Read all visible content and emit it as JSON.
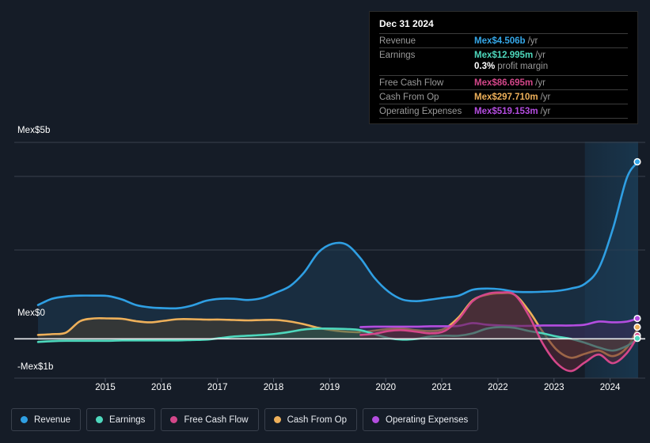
{
  "background_color": "#151c27",
  "tooltip": {
    "date": "Dec 31 2024",
    "rows": [
      {
        "label": "Revenue",
        "value": "Mex$4.506b",
        "unit": "/yr",
        "color": "#35a7e8"
      },
      {
        "label": "Earnings",
        "value": "Mex$12.995m",
        "unit": "/yr",
        "color": "#4ed8bd"
      },
      {
        "label": "",
        "value": "0.3%",
        "unit": "profit margin",
        "color": "#ffffff",
        "sub": true
      },
      {
        "label": "Free Cash Flow",
        "value": "Mex$86.695m",
        "unit": "/yr",
        "color": "#d4478a"
      },
      {
        "label": "Cash From Op",
        "value": "Mex$297.710m",
        "unit": "/yr",
        "color": "#eeb05a"
      },
      {
        "label": "Operating Expenses",
        "value": "Mex$519.153m",
        "unit": "/yr",
        "color": "#b44de0"
      }
    ]
  },
  "y_axis": {
    "top_label": "Mex$5b",
    "zero_label": "Mex$0",
    "bottom_label": "-Mex$1b"
  },
  "legend": {
    "items": [
      {
        "label": "Revenue",
        "color": "#2f9fe3"
      },
      {
        "label": "Earnings",
        "color": "#4ed8bd"
      },
      {
        "label": "Free Cash Flow",
        "color": "#d4478a"
      },
      {
        "label": "Cash From Op",
        "color": "#eeb05a"
      },
      {
        "label": "Operating Expenses",
        "color": "#b44de0"
      }
    ]
  },
  "chart_data": {
    "type": "area",
    "title": "",
    "xlabel": "",
    "ylabel": "Mex$",
    "ylim": [
      -1.0,
      5.0
    ],
    "y_ticks": [
      5.0,
      4.0,
      2.0,
      0.0,
      -1.0
    ],
    "y_tick_labels": [
      "Mex$5b",
      "",
      "",
      "Mex$0",
      "-Mex$1b"
    ],
    "grid": true,
    "legend_position": "bottom",
    "x_tick_labels": [
      "2015",
      "2016",
      "2017",
      "2018",
      "2019",
      "2020",
      "2021",
      "2022",
      "2023",
      "2024"
    ],
    "x": [
      2014.3,
      2014.55,
      2014.8,
      2015.05,
      2015.3,
      2015.55,
      2015.8,
      2016.05,
      2016.3,
      2016.55,
      2016.8,
      2017.05,
      2017.3,
      2017.55,
      2017.8,
      2018.05,
      2018.3,
      2018.55,
      2018.8,
      2019.05,
      2019.3,
      2019.55,
      2019.8,
      2020.05,
      2020.3,
      2020.55,
      2020.8,
      2021.05,
      2021.3,
      2021.55,
      2021.8,
      2022.05,
      2022.3,
      2022.55,
      2022.8,
      2023.05,
      2023.3,
      2023.55,
      2023.8,
      2024.05,
      2024.3,
      2024.55,
      2024.8,
      2025.0
    ],
    "forecast_start_x": 2024.05,
    "end_markers": [
      {
        "series": "Revenue",
        "value": 4.506,
        "color": "#35a7e8"
      },
      {
        "series": "Operating Expenses",
        "value": 0.519,
        "color": "#b44de0"
      },
      {
        "series": "Cash From Op",
        "value": 0.298,
        "color": "#eeb05a"
      },
      {
        "series": "Free Cash Flow",
        "value": 0.087,
        "color": "#d4478a"
      },
      {
        "series": "Earnings",
        "value": 0.013,
        "color": "#4ed8bd"
      }
    ],
    "series": [
      {
        "name": "Revenue",
        "color": "#2f9fe3",
        "fill": "#1d3c56",
        "values": [
          0.86,
          1.02,
          1.08,
          1.1,
          1.1,
          1.09,
          1.0,
          0.86,
          0.8,
          0.78,
          0.78,
          0.85,
          0.97,
          1.02,
          1.02,
          0.99,
          1.04,
          1.18,
          1.35,
          1.7,
          2.2,
          2.42,
          2.4,
          2.05,
          1.55,
          1.2,
          1.0,
          0.96,
          1.0,
          1.05,
          1.1,
          1.25,
          1.28,
          1.26,
          1.2,
          1.19,
          1.2,
          1.22,
          1.28,
          1.4,
          1.8,
          2.8,
          4.1,
          4.506
        ]
      },
      {
        "name": "Cash From Op",
        "color": "#eeb05a",
        "fill": "#4a4030",
        "values": [
          0.1,
          0.12,
          0.16,
          0.45,
          0.52,
          0.52,
          0.51,
          0.45,
          0.42,
          0.46,
          0.5,
          0.5,
          0.49,
          0.49,
          0.48,
          0.47,
          0.48,
          0.48,
          0.44,
          0.37,
          0.28,
          0.22,
          0.18,
          0.17,
          0.21,
          0.25,
          0.26,
          0.22,
          0.2,
          0.26,
          0.55,
          0.98,
          1.12,
          1.16,
          1.12,
          0.72,
          0.18,
          -0.28,
          -0.48,
          -0.38,
          -0.3,
          -0.44,
          -0.22,
          0.298
        ]
      },
      {
        "name": "Operating Expenses",
        "color": "#b44de0",
        "fill": "#3c2a55",
        "values": [
          null,
          null,
          null,
          null,
          null,
          null,
          null,
          null,
          null,
          null,
          null,
          null,
          null,
          null,
          null,
          null,
          null,
          null,
          null,
          null,
          null,
          null,
          null,
          0.3,
          0.31,
          0.31,
          0.31,
          0.31,
          0.32,
          0.32,
          0.33,
          0.4,
          0.36,
          0.34,
          0.33,
          0.33,
          0.34,
          0.34,
          0.34,
          0.36,
          0.44,
          0.42,
          0.44,
          0.519
        ]
      },
      {
        "name": "Earnings",
        "color": "#4ed8bd",
        "fill": "#2b5a52",
        "values": [
          -0.08,
          -0.06,
          -0.05,
          -0.05,
          -0.05,
          -0.05,
          -0.04,
          -0.04,
          -0.04,
          -0.04,
          -0.04,
          -0.03,
          -0.02,
          0.02,
          0.06,
          0.08,
          0.1,
          0.13,
          0.18,
          0.24,
          0.26,
          0.26,
          0.25,
          0.22,
          0.12,
          0.02,
          -0.02,
          0.0,
          0.06,
          0.08,
          0.08,
          0.14,
          0.26,
          0.3,
          0.28,
          0.2,
          0.14,
          0.06,
          0.0,
          -0.1,
          -0.22,
          -0.3,
          -0.18,
          0.013
        ]
      },
      {
        "name": "Free Cash Flow",
        "color": "#d4478a",
        "fill": "#5a2838",
        "values": [
          null,
          null,
          null,
          null,
          null,
          null,
          null,
          null,
          null,
          null,
          null,
          null,
          null,
          null,
          null,
          null,
          null,
          null,
          null,
          null,
          null,
          null,
          null,
          0.1,
          0.13,
          0.2,
          0.22,
          0.18,
          0.14,
          0.2,
          0.5,
          0.96,
          1.14,
          1.18,
          1.12,
          0.6,
          -0.12,
          -0.62,
          -0.82,
          -0.6,
          -0.4,
          -0.62,
          -0.36,
          0.087
        ]
      }
    ]
  }
}
